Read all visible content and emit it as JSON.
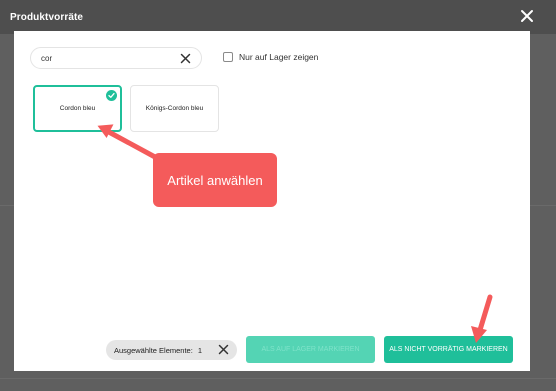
{
  "modal": {
    "title": "Produktvorräte"
  },
  "search": {
    "value": "cor"
  },
  "filter": {
    "label": "Nur auf Lager zeigen",
    "checked": false
  },
  "products": [
    {
      "name": "Cordon bleu",
      "selected": true
    },
    {
      "name": "Königs-Cordon bleu",
      "selected": false
    }
  ],
  "annotation": {
    "text": "Artikel anwählen"
  },
  "footer": {
    "selected_label": "Ausgewählte Elemente:",
    "selected_count": "1",
    "mark_available_label": "ALS AUF LAGER MARKIEREN",
    "mark_unavailable_label": "ALS NICHT VORRÄTIG MARKIEREN"
  },
  "colors": {
    "accent": "#1fbf9a",
    "callout": "#f45b5b"
  }
}
